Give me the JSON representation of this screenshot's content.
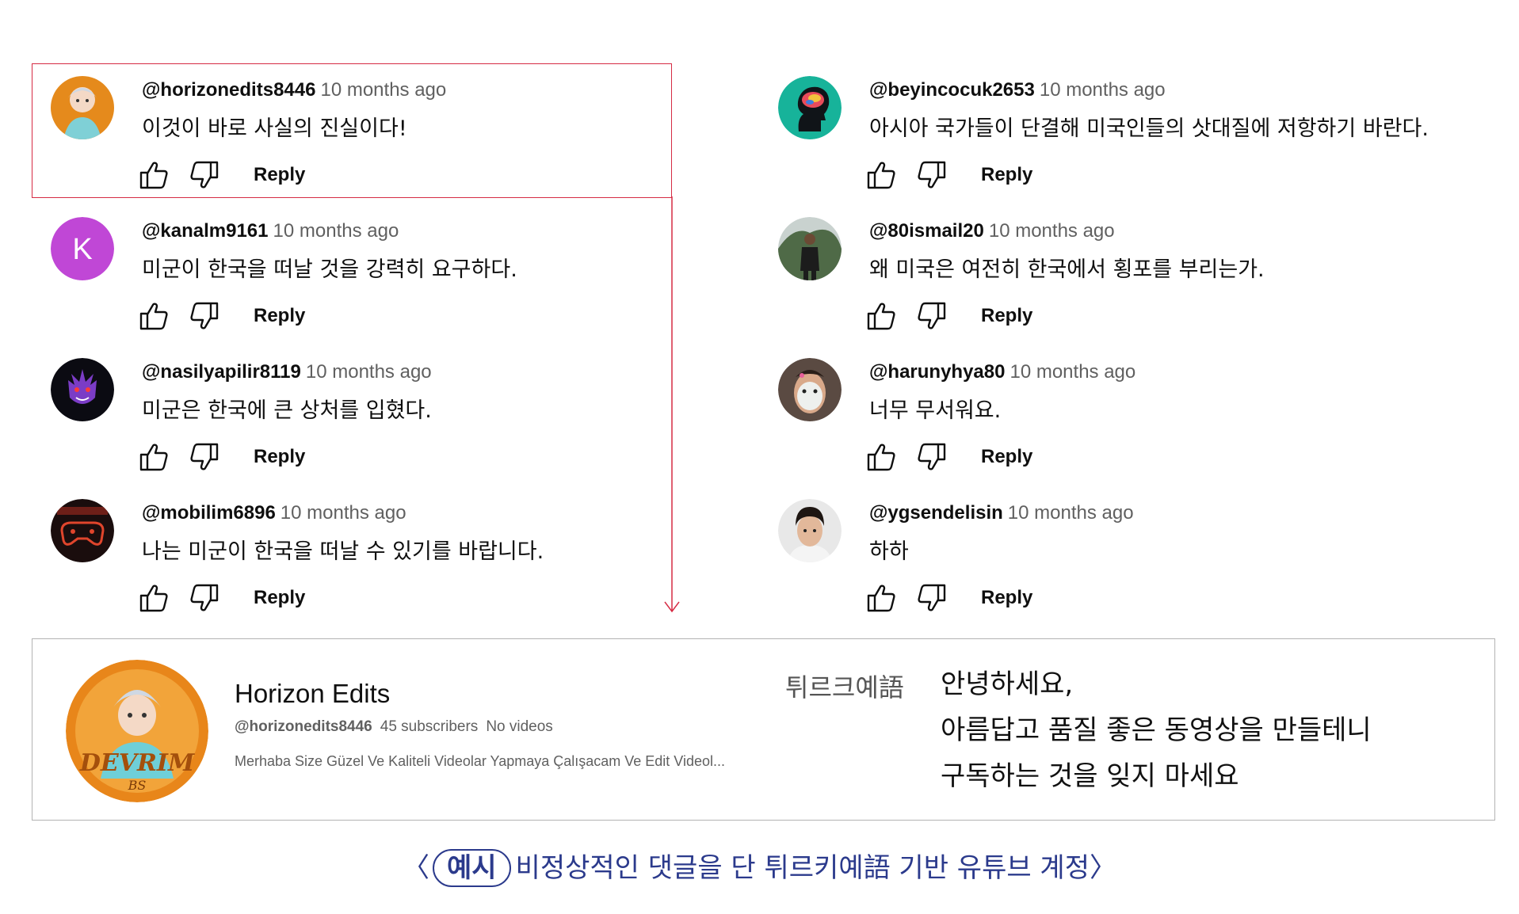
{
  "comments_left": [
    {
      "handle": "@horizonedits8446",
      "time": "10 months ago",
      "text": "이것이 바로 사실의 진실이다!",
      "reply": "Reply",
      "avatar": "anime-girl-avatar"
    },
    {
      "handle": "@kanalm9161",
      "time": "10 months ago",
      "text": "미군이 한국을 떠날 것을 강력히 요구하다.",
      "reply": "Reply",
      "avatar": "letter-avatar",
      "avatar_letter": "K",
      "avatar_color": "#c047d6"
    },
    {
      "handle": "@nasilyapilir8119",
      "time": "10 months ago",
      "text": "미군은 한국에 큰 상처를 입혔다.",
      "reply": "Reply",
      "avatar": "purple-ghost-avatar"
    },
    {
      "handle": "@mobilim6896",
      "time": "10 months ago",
      "text": "나는 미군이 한국을 떠날 수 있기를 바랍니다.",
      "reply": "Reply",
      "avatar": "gamepad-logo-avatar"
    }
  ],
  "comments_right": [
    {
      "handle": "@beyincocuk2653",
      "time": "10 months ago",
      "text": "아시아 국가들이 단결해 미국인들의 삿대질에 저항하기 바란다.",
      "reply": "Reply",
      "avatar": "brain-head-avatar"
    },
    {
      "handle": "@80ismail20",
      "time": "10 months ago",
      "text": "왜 미국은 여전히 한국에서 횡포를 부리는가.",
      "reply": "Reply",
      "avatar": "person-outdoor-avatar"
    },
    {
      "handle": "@harunyhya80",
      "time": "10 months ago",
      "text": "너무 무서워요.",
      "reply": "Reply",
      "avatar": "face-mask-avatar"
    },
    {
      "handle": "@ygsendelisin",
      "time": "10 months ago",
      "text": "하하",
      "reply": "Reply",
      "avatar": "young-man-avatar"
    }
  ],
  "channel": {
    "name": "Horizon Edits",
    "handle": "@horizonedits8446",
    "subscribers": "45 subscribers",
    "videos": "No videos",
    "description": "Merhaba Size Güzel Ve Kaliteli Videolar Yapmaya Çalışacam Ve Edit Videol...",
    "avatar_text": "DEVRIM",
    "avatar_subtext": "BS"
  },
  "translation": {
    "label": "튀르크예語",
    "lines": [
      "안녕하세요,",
      "아름답고 품질 좋은 동영상을 만들테니",
      "구독하는 것을 잊지 마세요"
    ]
  },
  "caption": {
    "open": "〈",
    "tag": "예시",
    "text": "비정상적인 댓글을 단 튀르키예語 기반 유튜브 계정",
    "close": "〉"
  },
  "colors": {
    "highlight": "#d62b44",
    "caption": "#2b3a8c",
    "time_text": "#606060"
  }
}
